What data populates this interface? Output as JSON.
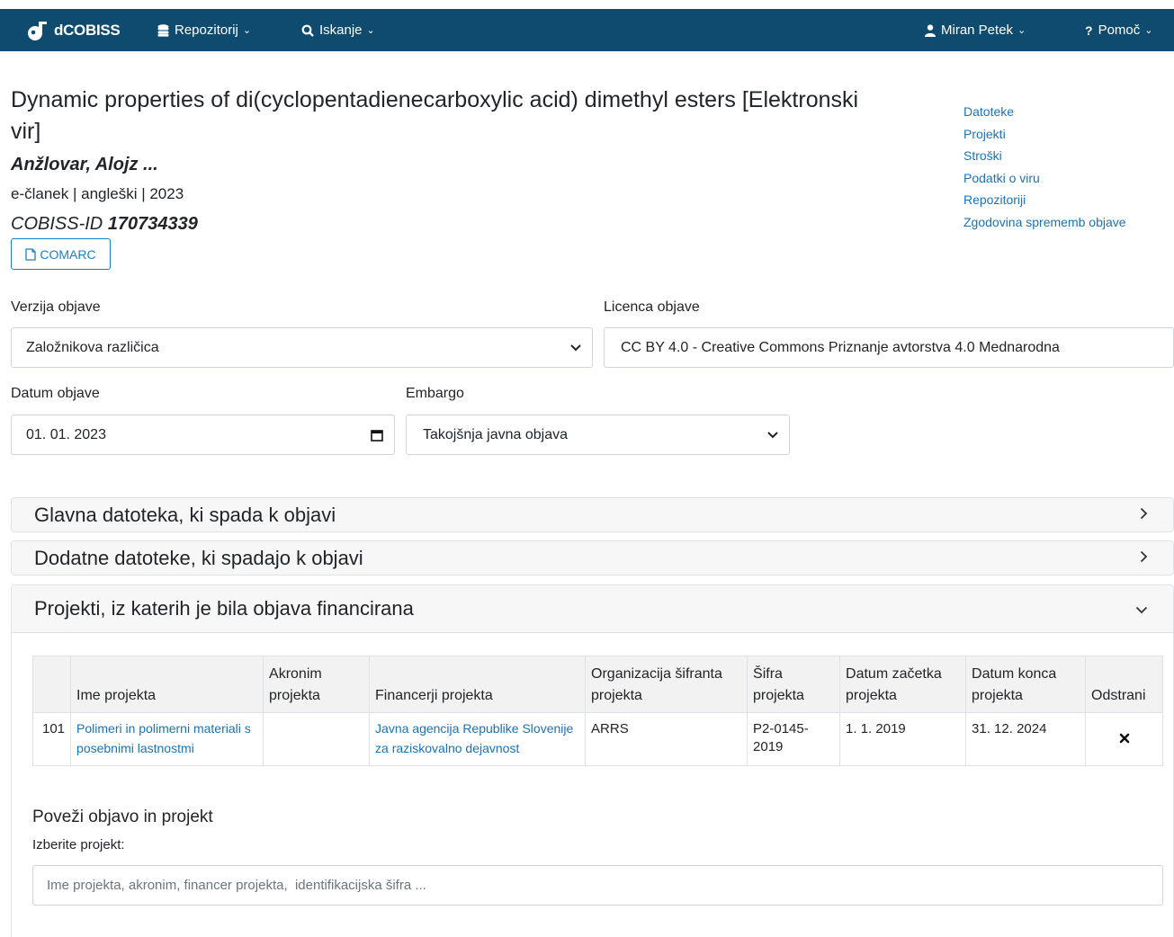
{
  "navbar": {
    "brand": "dCOBISS",
    "repo": "Repozitorij",
    "search": "Iskanje",
    "user": "Miran Petek",
    "help": "Pomoč"
  },
  "record": {
    "title": "Dynamic properties of di(cyclopentadienecarboxylic acid) dimethyl esters [Elektronski vir]",
    "author": "Anžlovar, Alojz ...",
    "meta": "e-članek | angleški | 2023",
    "cobiss_prefix": "COBISS-ID",
    "cobiss_id": "170734339",
    "comarc_button": "COMARC"
  },
  "side_links": [
    "Datoteke",
    "Projekti",
    "Stroški",
    "Podatki o viru",
    "Repozitoriji",
    "Zgodovina sprememb objave"
  ],
  "form": {
    "version_label": "Verzija objave",
    "version_value": "Založnikova različica",
    "license_label": "Licenca objave",
    "license_value": "CC BY 4.0 - Creative Commons Priznanje avtorstva 4.0 Mednarodna",
    "date_label": "Datum objave",
    "date_value": "01. 01. 2023",
    "embargo_label": "Embargo",
    "embargo_value": "Takojšnja javna objava"
  },
  "accordion": {
    "main_file": "Glavna datoteka, ki spada k objavi",
    "extra_files": "Dodatne datoteke, ki spadajo k objavi",
    "projects": "Projekti, iz katerih je bila objava financirana"
  },
  "table": {
    "headers": [
      "",
      "Ime projekta",
      "Akronim projekta",
      "Financerji projekta",
      "Organizacija šifranta projekta",
      "Šifra projekta",
      "Datum začetka projekta",
      "Datum konca projekta",
      "Odstrani"
    ],
    "row": {
      "num": "101",
      "name": "Polimeri in polimerni materiali s posebnimi lastnostmi",
      "acronym": "",
      "funder": "Javna agencija Republike Slovenije za raziskovalno dejavnost",
      "org": "ARRS",
      "code": "P2-0145-2019",
      "start": "1. 1. 2019",
      "end": "31. 12. 2024"
    }
  },
  "link_project": {
    "title": "Poveži objavo in projekt",
    "subtitle": "Izberite projekt:",
    "placeholder": "Ime projekta, akronim, financer projekta,  identifikacijska šifra ..."
  }
}
